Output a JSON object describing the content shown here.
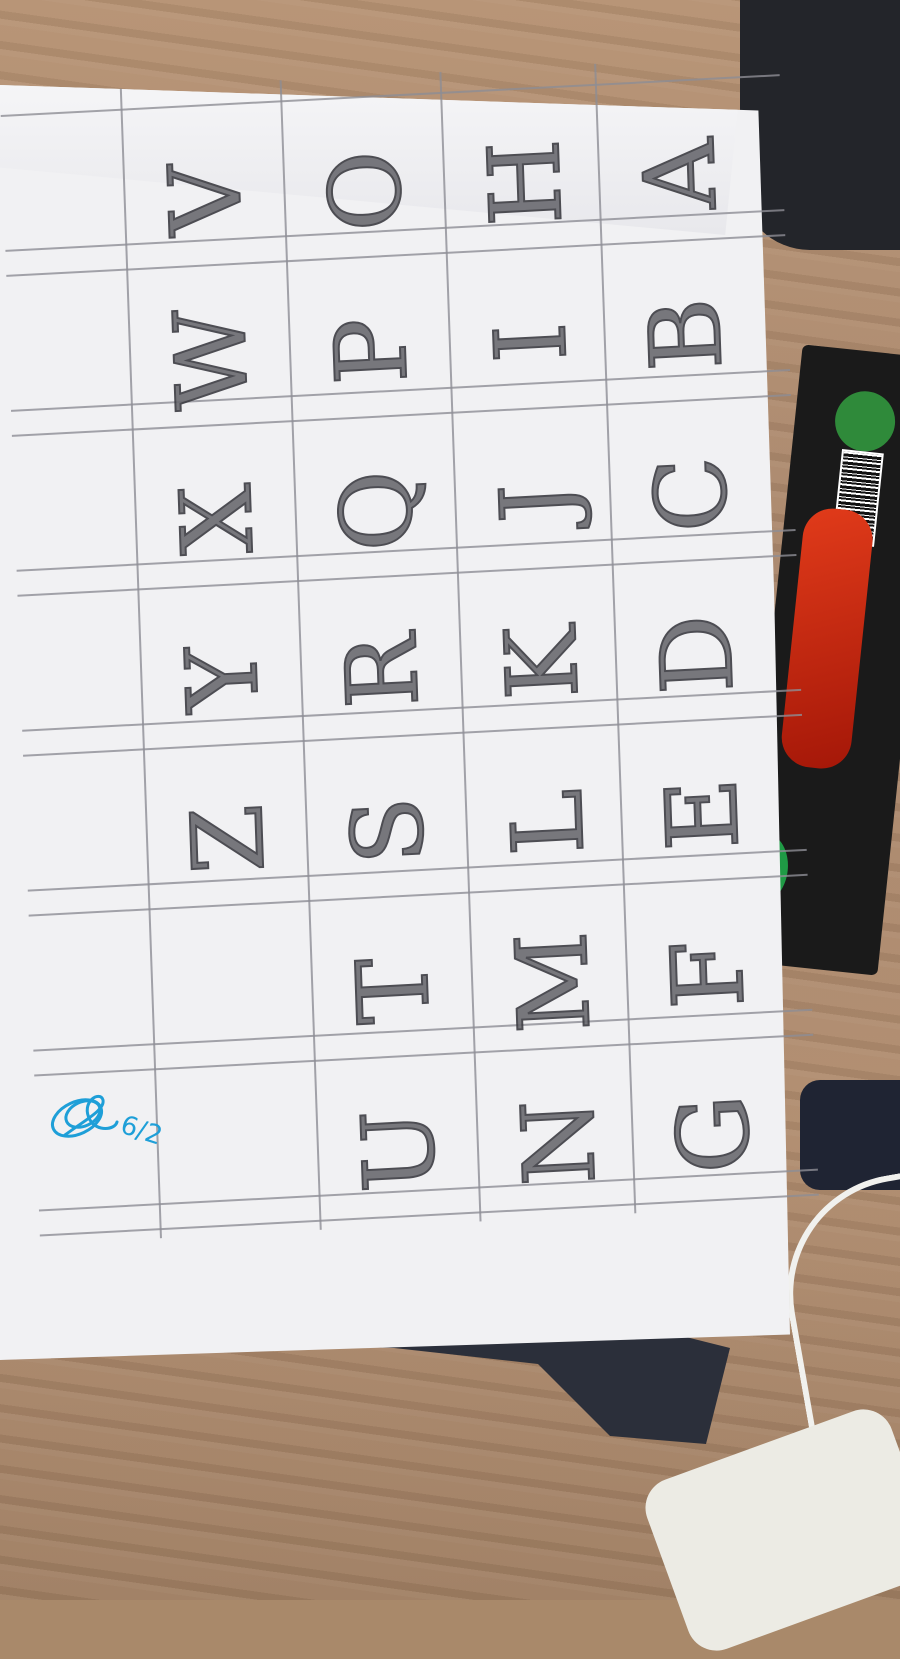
{
  "letter_grid": {
    "rows": [
      [
        "A",
        "B",
        "C",
        "D",
        "E",
        "F",
        "G"
      ],
      [
        "H",
        "I",
        "J",
        "K",
        "L",
        "M",
        "N"
      ],
      [
        "O",
        "P",
        "Q",
        "R",
        "S",
        "T",
        "U"
      ],
      [
        "V",
        "W",
        "X",
        "Y",
        "Z",
        "",
        ""
      ]
    ]
  },
  "signature": {
    "text": "6/2",
    "ink_color": "#1e9fd8"
  },
  "colors": {
    "pencil": "#3c3c42",
    "paper": "#f1f1f3",
    "table": "#a9896a"
  }
}
